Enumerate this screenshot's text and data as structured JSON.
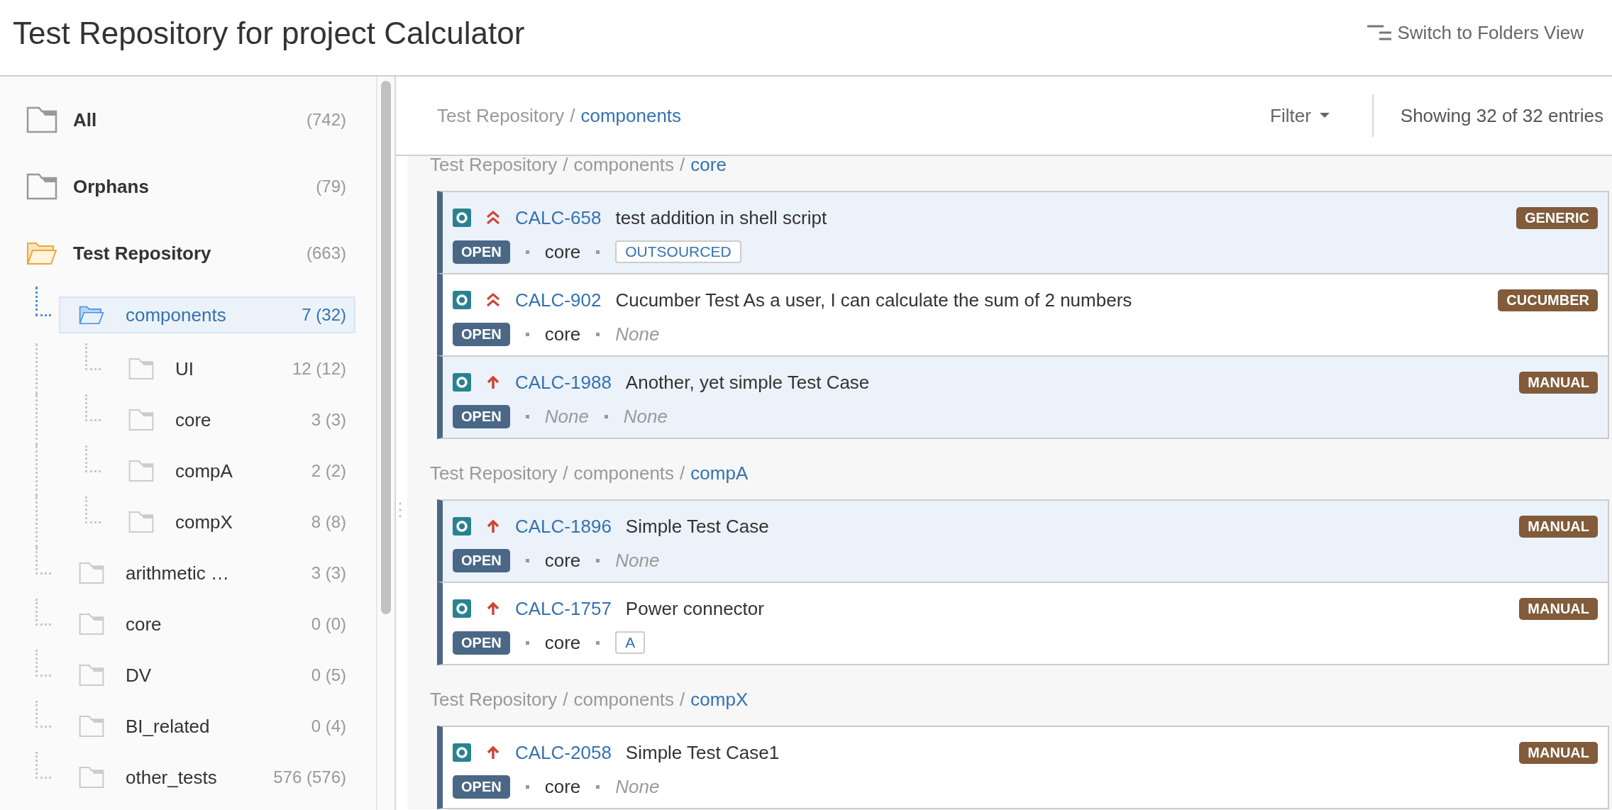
{
  "header": {
    "title": "Test Repository for project Calculator",
    "switch_view": "Switch to Folders View"
  },
  "tree": [
    {
      "label": "All",
      "count": "(742)",
      "selected": false,
      "expanded": false
    },
    {
      "label": "Orphans",
      "count": "(79)",
      "selected": false,
      "expanded": false
    },
    {
      "label": "Test Repository",
      "count": "(663)",
      "selected": false,
      "expanded": true,
      "children": [
        {
          "label": "components",
          "count": "7 (32)",
          "selected": true,
          "expanded": true,
          "children": [
            {
              "label": "UI",
              "count": "12 (12)",
              "selected": false,
              "expanded": false
            },
            {
              "label": "core",
              "count": "3 (3)",
              "selected": false,
              "expanded": false
            },
            {
              "label": "compA",
              "count": "2 (2)",
              "selected": false,
              "expanded": false
            },
            {
              "label": "compX",
              "count": "8 (8)",
              "selected": false,
              "expanded": false
            }
          ]
        },
        {
          "label": "arithmetic …",
          "count": "3 (3)",
          "selected": false,
          "expanded": false
        },
        {
          "label": "core",
          "count": "0 (0)",
          "selected": false,
          "expanded": false
        },
        {
          "label": "DV",
          "count": "0 (5)",
          "selected": false,
          "expanded": false
        },
        {
          "label": "BI_related",
          "count": "0 (4)",
          "selected": false,
          "expanded": false
        },
        {
          "label": "other_tests",
          "count": "576 (576)",
          "selected": false,
          "expanded": false
        }
      ]
    }
  ],
  "toolbar": {
    "breadcrumb": [
      "Test Repository",
      "components"
    ],
    "separator": "/",
    "filter": "Filter",
    "showing": "Showing 32 of 32 entries"
  },
  "groups": [
    {
      "path": [
        "Test Repository",
        "components",
        "core"
      ],
      "tests": [
        {
          "key": "CALC-658",
          "summary": "test addition in shell script",
          "kind": "highest",
          "status": "OPEN",
          "type": "GENERIC",
          "selected": true,
          "fields": [
            {
              "kind": "value",
              "text": "core"
            },
            {
              "kind": "tag",
              "text": "OUTSOURCED"
            }
          ]
        },
        {
          "key": "CALC-902",
          "summary": "Cucumber Test As a user, I can calculate the sum of 2 numbers",
          "kind": "highest",
          "status": "OPEN",
          "type": "CUCUMBER",
          "selected": false,
          "fields": [
            {
              "kind": "value",
              "text": "core"
            },
            {
              "kind": "none",
              "text": "None"
            }
          ]
        },
        {
          "key": "CALC-1988",
          "summary": "Another, yet simple Test Case",
          "kind": "high",
          "status": "OPEN",
          "type": "MANUAL",
          "selected": true,
          "fields": [
            {
              "kind": "none",
              "text": "None"
            },
            {
              "kind": "none",
              "text": "None"
            }
          ]
        }
      ]
    },
    {
      "path": [
        "Test Repository",
        "components",
        "compA"
      ],
      "tests": [
        {
          "key": "CALC-1896",
          "summary": "Simple Test Case",
          "kind": "high",
          "status": "OPEN",
          "type": "MANUAL",
          "selected": true,
          "fields": [
            {
              "kind": "value",
              "text": "core"
            },
            {
              "kind": "none",
              "text": "None"
            }
          ]
        },
        {
          "key": "CALC-1757",
          "summary": "Power connector",
          "kind": "high",
          "status": "OPEN",
          "type": "MANUAL",
          "selected": false,
          "fields": [
            {
              "kind": "value",
              "text": "core"
            },
            {
              "kind": "tag",
              "text": "A"
            }
          ]
        }
      ]
    },
    {
      "path": [
        "Test Repository",
        "components",
        "compX"
      ],
      "tests": [
        {
          "key": "CALC-2058",
          "summary": "Simple Test Case1",
          "kind": "high",
          "status": "OPEN",
          "type": "MANUAL",
          "selected": false,
          "fields": [
            {
              "kind": "value",
              "text": "core"
            },
            {
              "kind": "none",
              "text": "None"
            }
          ]
        }
      ]
    }
  ]
}
